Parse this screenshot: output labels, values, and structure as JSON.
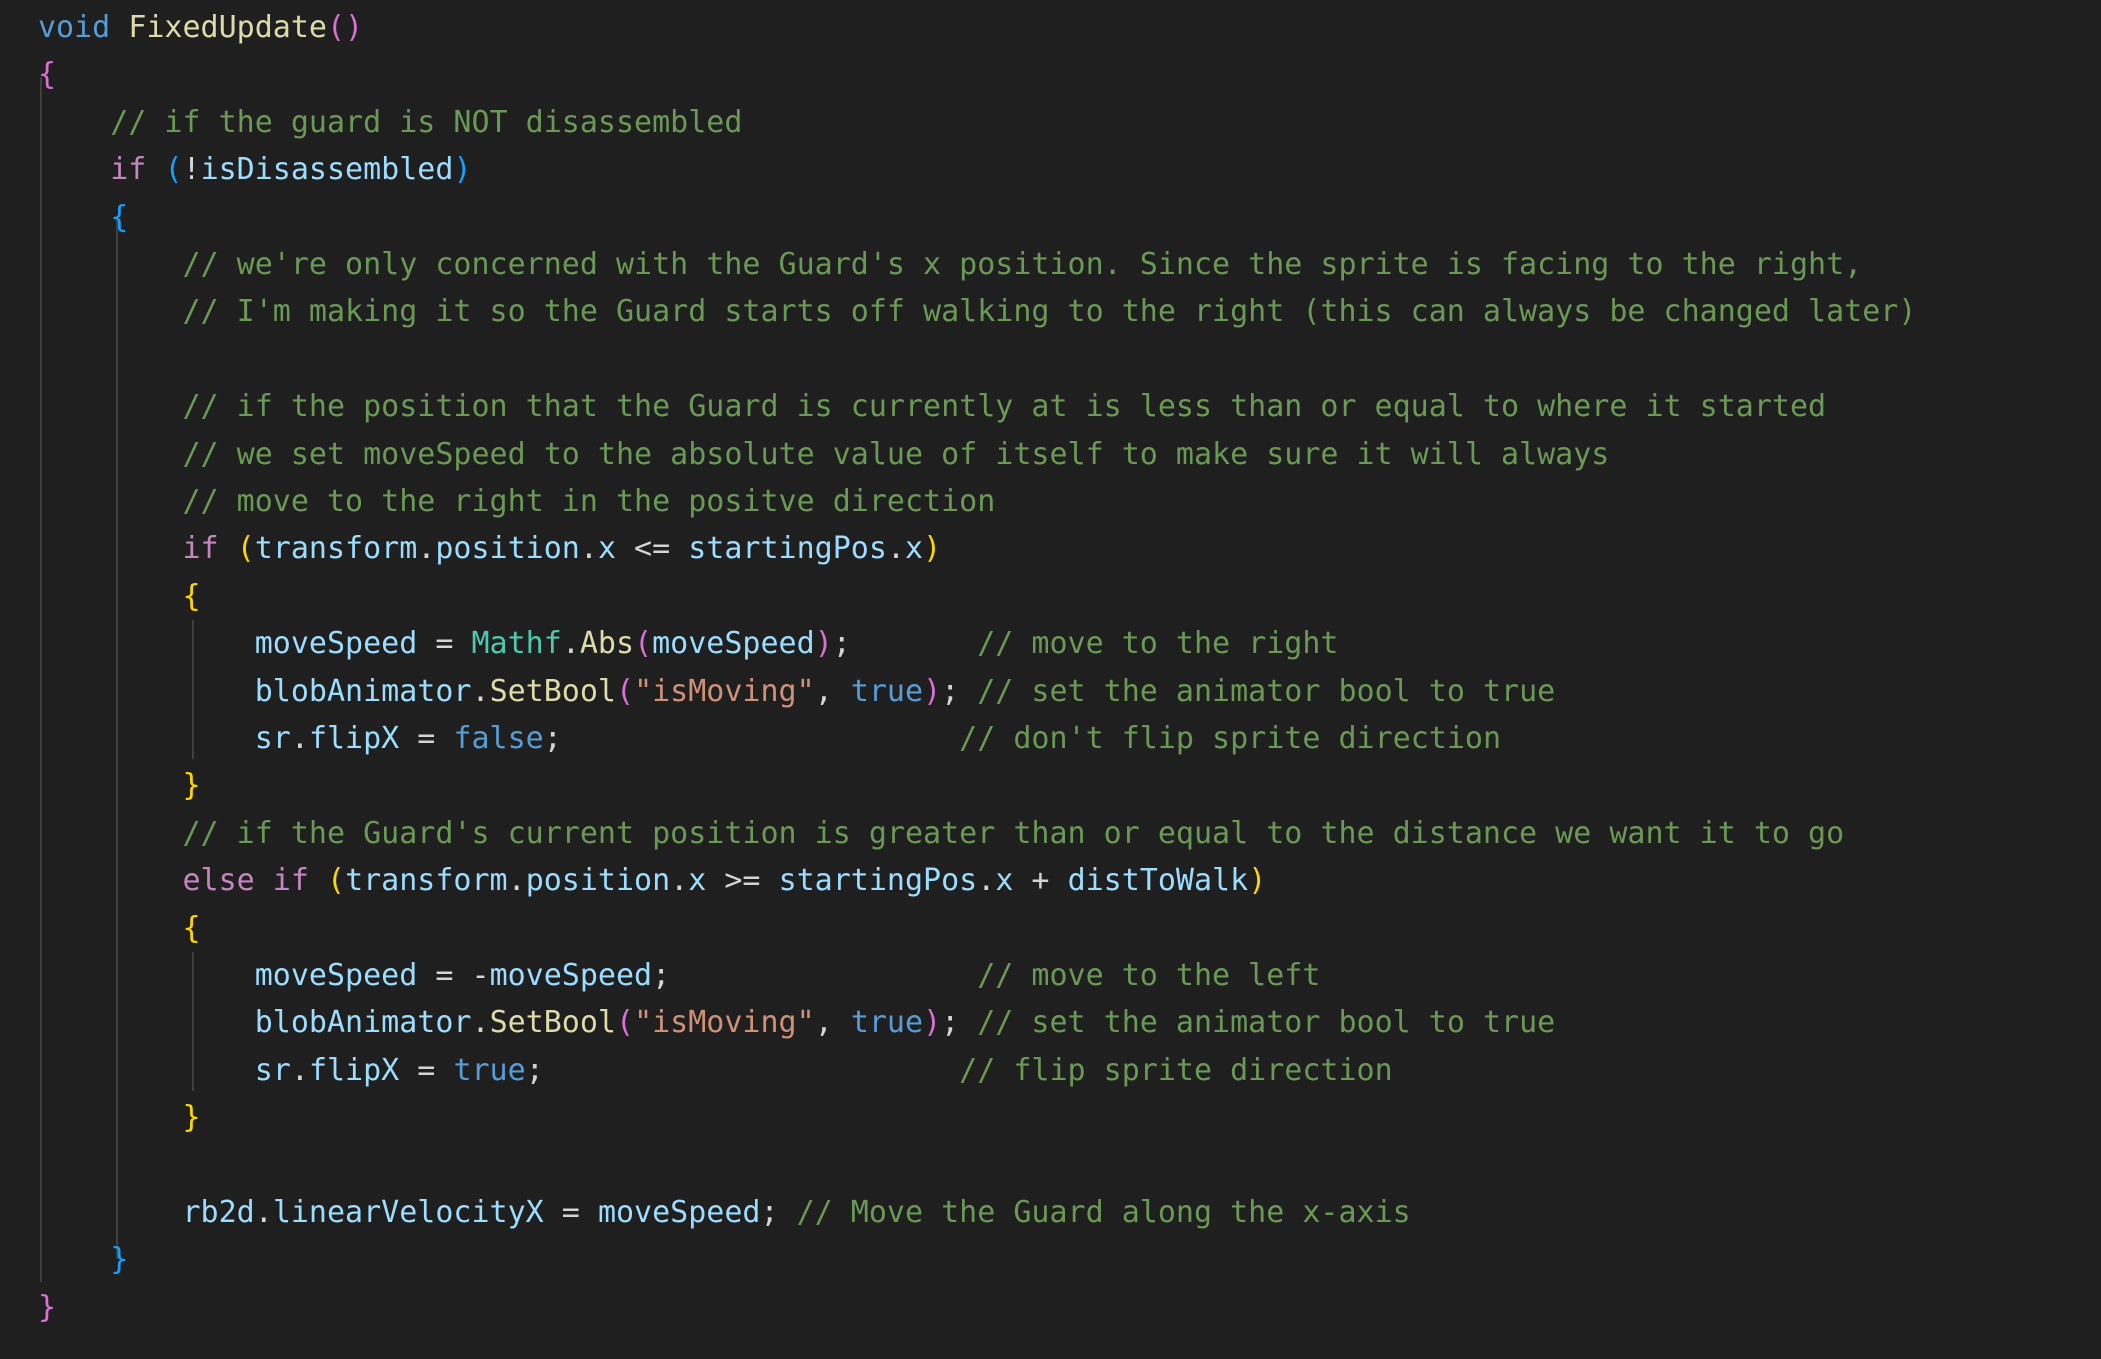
{
  "editor": {
    "language": "csharp",
    "theme_colors": {
      "background": "#1f1f1f",
      "keyword": "#569cd6",
      "control": "#c586c0",
      "function": "#dcdcaa",
      "type": "#4ec9b0",
      "string": "#ce9178",
      "comment": "#6a9955",
      "variable": "#9cdcfe",
      "punctuation": "#d4d4d4",
      "bracket_1": "#da70d6",
      "bracket_2": "#179fff",
      "bracket_3": "#ffd700"
    },
    "lines": [
      [
        [
          "kw",
          "void"
        ],
        [
          "punc",
          " "
        ],
        [
          "fn",
          "FixedUpdate"
        ],
        [
          "br1",
          "()"
        ]
      ],
      [
        [
          "br1",
          "{"
        ]
      ],
      [
        [
          "punc",
          "    "
        ],
        [
          "cmt",
          "// if the guard is NOT disassembled"
        ]
      ],
      [
        [
          "punc",
          "    "
        ],
        [
          "ctrl",
          "if"
        ],
        [
          "punc",
          " "
        ],
        [
          "br2",
          "("
        ],
        [
          "punc",
          "!"
        ],
        [
          "var",
          "isDisassembled"
        ],
        [
          "br2",
          ")"
        ]
      ],
      [
        [
          "punc",
          "    "
        ],
        [
          "br2",
          "{"
        ]
      ],
      [
        [
          "punc",
          "        "
        ],
        [
          "cmt",
          "// we're only concerned with the Guard's x position. Since the sprite is facing to the right,"
        ]
      ],
      [
        [
          "punc",
          "        "
        ],
        [
          "cmt",
          "// I'm making it so the Guard starts off walking to the right (this can always be changed later)"
        ]
      ],
      [],
      [
        [
          "punc",
          "        "
        ],
        [
          "cmt",
          "// if the position that the Guard is currently at is less than or equal to where it started"
        ]
      ],
      [
        [
          "punc",
          "        "
        ],
        [
          "cmt",
          "// we set moveSpeed to the absolute value of itself to make sure it will always"
        ]
      ],
      [
        [
          "punc",
          "        "
        ],
        [
          "cmt",
          "// move to the right in the positve direction"
        ]
      ],
      [
        [
          "punc",
          "        "
        ],
        [
          "ctrl",
          "if"
        ],
        [
          "punc",
          " "
        ],
        [
          "br3",
          "("
        ],
        [
          "var",
          "transform"
        ],
        [
          "punc",
          "."
        ],
        [
          "var",
          "position"
        ],
        [
          "punc",
          "."
        ],
        [
          "var",
          "x"
        ],
        [
          "punc",
          " <= "
        ],
        [
          "var",
          "startingPos"
        ],
        [
          "punc",
          "."
        ],
        [
          "var",
          "x"
        ],
        [
          "br3",
          ")"
        ]
      ],
      [
        [
          "punc",
          "        "
        ],
        [
          "br3",
          "{"
        ]
      ],
      [
        [
          "punc",
          "            "
        ],
        [
          "var",
          "moveSpeed"
        ],
        [
          "punc",
          " = "
        ],
        [
          "type",
          "Mathf"
        ],
        [
          "punc",
          "."
        ],
        [
          "fn",
          "Abs"
        ],
        [
          "br1",
          "("
        ],
        [
          "var",
          "moveSpeed"
        ],
        [
          "br1",
          ")"
        ],
        [
          "punc",
          ";       "
        ],
        [
          "cmt",
          "// move to the right"
        ]
      ],
      [
        [
          "punc",
          "            "
        ],
        [
          "var",
          "blobAnimator"
        ],
        [
          "punc",
          "."
        ],
        [
          "fn",
          "SetBool"
        ],
        [
          "br1",
          "("
        ],
        [
          "str",
          "\"isMoving\""
        ],
        [
          "punc",
          ", "
        ],
        [
          "kw",
          "true"
        ],
        [
          "br1",
          ")"
        ],
        [
          "punc",
          "; "
        ],
        [
          "cmt",
          "// set the animator bool to true"
        ]
      ],
      [
        [
          "punc",
          "            "
        ],
        [
          "var",
          "sr"
        ],
        [
          "punc",
          "."
        ],
        [
          "var",
          "flipX"
        ],
        [
          "punc",
          " = "
        ],
        [
          "kw",
          "false"
        ],
        [
          "punc",
          ";                      "
        ],
        [
          "cmt",
          "// don't flip sprite direction"
        ]
      ],
      [
        [
          "punc",
          "        "
        ],
        [
          "br3",
          "}"
        ]
      ],
      [
        [
          "punc",
          "        "
        ],
        [
          "cmt",
          "// if the Guard's current position is greater than or equal to the distance we want it to go"
        ]
      ],
      [
        [
          "punc",
          "        "
        ],
        [
          "ctrl",
          "else if"
        ],
        [
          "punc",
          " "
        ],
        [
          "br3",
          "("
        ],
        [
          "var",
          "transform"
        ],
        [
          "punc",
          "."
        ],
        [
          "var",
          "position"
        ],
        [
          "punc",
          "."
        ],
        [
          "var",
          "x"
        ],
        [
          "punc",
          " >= "
        ],
        [
          "var",
          "startingPos"
        ],
        [
          "punc",
          "."
        ],
        [
          "var",
          "x"
        ],
        [
          "punc",
          " + "
        ],
        [
          "var",
          "distToWalk"
        ],
        [
          "br3",
          ")"
        ]
      ],
      [
        [
          "punc",
          "        "
        ],
        [
          "br3",
          "{"
        ]
      ],
      [
        [
          "punc",
          "            "
        ],
        [
          "var",
          "moveSpeed"
        ],
        [
          "punc",
          " = -"
        ],
        [
          "var",
          "moveSpeed"
        ],
        [
          "punc",
          ";                 "
        ],
        [
          "cmt",
          "// move to the left"
        ]
      ],
      [
        [
          "punc",
          "            "
        ],
        [
          "var",
          "blobAnimator"
        ],
        [
          "punc",
          "."
        ],
        [
          "fn",
          "SetBool"
        ],
        [
          "br1",
          "("
        ],
        [
          "str",
          "\"isMoving\""
        ],
        [
          "punc",
          ", "
        ],
        [
          "kw",
          "true"
        ],
        [
          "br1",
          ")"
        ],
        [
          "punc",
          "; "
        ],
        [
          "cmt",
          "// set the animator bool to true"
        ]
      ],
      [
        [
          "punc",
          "            "
        ],
        [
          "var",
          "sr"
        ],
        [
          "punc",
          "."
        ],
        [
          "var",
          "flipX"
        ],
        [
          "punc",
          " = "
        ],
        [
          "kw",
          "true"
        ],
        [
          "punc",
          ";                       "
        ],
        [
          "cmt",
          "// flip sprite direction"
        ]
      ],
      [
        [
          "punc",
          "        "
        ],
        [
          "br3",
          "}"
        ]
      ],
      [],
      [
        [
          "punc",
          "        "
        ],
        [
          "var",
          "rb2d"
        ],
        [
          "punc",
          "."
        ],
        [
          "var",
          "linearVelocityX"
        ],
        [
          "punc",
          " = "
        ],
        [
          "var",
          "moveSpeed"
        ],
        [
          "punc",
          "; "
        ],
        [
          "cmt",
          "// Move the Guard along the x-axis"
        ]
      ],
      [
        [
          "punc",
          "    "
        ],
        [
          "br2",
          "}"
        ]
      ],
      [
        [
          "br1",
          "}"
        ]
      ]
    ]
  }
}
